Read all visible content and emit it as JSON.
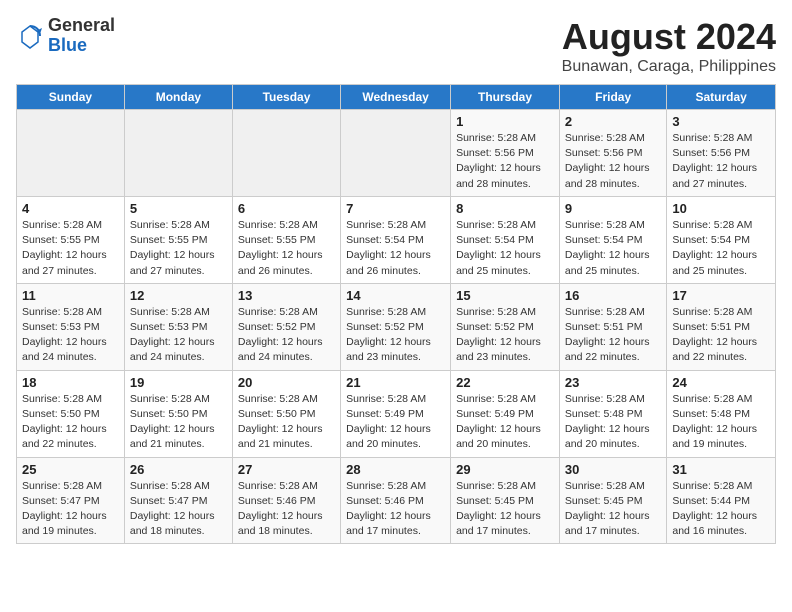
{
  "logo": {
    "general": "General",
    "blue": "Blue"
  },
  "title": "August 2024",
  "location": "Bunawan, Caraga, Philippines",
  "days": [
    "Sunday",
    "Monday",
    "Tuesday",
    "Wednesday",
    "Thursday",
    "Friday",
    "Saturday"
  ],
  "weeks": [
    [
      {
        "date": "",
        "info": ""
      },
      {
        "date": "",
        "info": ""
      },
      {
        "date": "",
        "info": ""
      },
      {
        "date": "",
        "info": ""
      },
      {
        "date": "1",
        "info": "Sunrise: 5:28 AM\nSunset: 5:56 PM\nDaylight: 12 hours\nand 28 minutes."
      },
      {
        "date": "2",
        "info": "Sunrise: 5:28 AM\nSunset: 5:56 PM\nDaylight: 12 hours\nand 28 minutes."
      },
      {
        "date": "3",
        "info": "Sunrise: 5:28 AM\nSunset: 5:56 PM\nDaylight: 12 hours\nand 27 minutes."
      }
    ],
    [
      {
        "date": "4",
        "info": "Sunrise: 5:28 AM\nSunset: 5:55 PM\nDaylight: 12 hours\nand 27 minutes."
      },
      {
        "date": "5",
        "info": "Sunrise: 5:28 AM\nSunset: 5:55 PM\nDaylight: 12 hours\nand 27 minutes."
      },
      {
        "date": "6",
        "info": "Sunrise: 5:28 AM\nSunset: 5:55 PM\nDaylight: 12 hours\nand 26 minutes."
      },
      {
        "date": "7",
        "info": "Sunrise: 5:28 AM\nSunset: 5:54 PM\nDaylight: 12 hours\nand 26 minutes."
      },
      {
        "date": "8",
        "info": "Sunrise: 5:28 AM\nSunset: 5:54 PM\nDaylight: 12 hours\nand 25 minutes."
      },
      {
        "date": "9",
        "info": "Sunrise: 5:28 AM\nSunset: 5:54 PM\nDaylight: 12 hours\nand 25 minutes."
      },
      {
        "date": "10",
        "info": "Sunrise: 5:28 AM\nSunset: 5:54 PM\nDaylight: 12 hours\nand 25 minutes."
      }
    ],
    [
      {
        "date": "11",
        "info": "Sunrise: 5:28 AM\nSunset: 5:53 PM\nDaylight: 12 hours\nand 24 minutes."
      },
      {
        "date": "12",
        "info": "Sunrise: 5:28 AM\nSunset: 5:53 PM\nDaylight: 12 hours\nand 24 minutes."
      },
      {
        "date": "13",
        "info": "Sunrise: 5:28 AM\nSunset: 5:52 PM\nDaylight: 12 hours\nand 24 minutes."
      },
      {
        "date": "14",
        "info": "Sunrise: 5:28 AM\nSunset: 5:52 PM\nDaylight: 12 hours\nand 23 minutes."
      },
      {
        "date": "15",
        "info": "Sunrise: 5:28 AM\nSunset: 5:52 PM\nDaylight: 12 hours\nand 23 minutes."
      },
      {
        "date": "16",
        "info": "Sunrise: 5:28 AM\nSunset: 5:51 PM\nDaylight: 12 hours\nand 22 minutes."
      },
      {
        "date": "17",
        "info": "Sunrise: 5:28 AM\nSunset: 5:51 PM\nDaylight: 12 hours\nand 22 minutes."
      }
    ],
    [
      {
        "date": "18",
        "info": "Sunrise: 5:28 AM\nSunset: 5:50 PM\nDaylight: 12 hours\nand 22 minutes."
      },
      {
        "date": "19",
        "info": "Sunrise: 5:28 AM\nSunset: 5:50 PM\nDaylight: 12 hours\nand 21 minutes."
      },
      {
        "date": "20",
        "info": "Sunrise: 5:28 AM\nSunset: 5:50 PM\nDaylight: 12 hours\nand 21 minutes."
      },
      {
        "date": "21",
        "info": "Sunrise: 5:28 AM\nSunset: 5:49 PM\nDaylight: 12 hours\nand 20 minutes."
      },
      {
        "date": "22",
        "info": "Sunrise: 5:28 AM\nSunset: 5:49 PM\nDaylight: 12 hours\nand 20 minutes."
      },
      {
        "date": "23",
        "info": "Sunrise: 5:28 AM\nSunset: 5:48 PM\nDaylight: 12 hours\nand 20 minutes."
      },
      {
        "date": "24",
        "info": "Sunrise: 5:28 AM\nSunset: 5:48 PM\nDaylight: 12 hours\nand 19 minutes."
      }
    ],
    [
      {
        "date": "25",
        "info": "Sunrise: 5:28 AM\nSunset: 5:47 PM\nDaylight: 12 hours\nand 19 minutes."
      },
      {
        "date": "26",
        "info": "Sunrise: 5:28 AM\nSunset: 5:47 PM\nDaylight: 12 hours\nand 18 minutes."
      },
      {
        "date": "27",
        "info": "Sunrise: 5:28 AM\nSunset: 5:46 PM\nDaylight: 12 hours\nand 18 minutes."
      },
      {
        "date": "28",
        "info": "Sunrise: 5:28 AM\nSunset: 5:46 PM\nDaylight: 12 hours\nand 17 minutes."
      },
      {
        "date": "29",
        "info": "Sunrise: 5:28 AM\nSunset: 5:45 PM\nDaylight: 12 hours\nand 17 minutes."
      },
      {
        "date": "30",
        "info": "Sunrise: 5:28 AM\nSunset: 5:45 PM\nDaylight: 12 hours\nand 17 minutes."
      },
      {
        "date": "31",
        "info": "Sunrise: 5:28 AM\nSunset: 5:44 PM\nDaylight: 12 hours\nand 16 minutes."
      }
    ]
  ]
}
